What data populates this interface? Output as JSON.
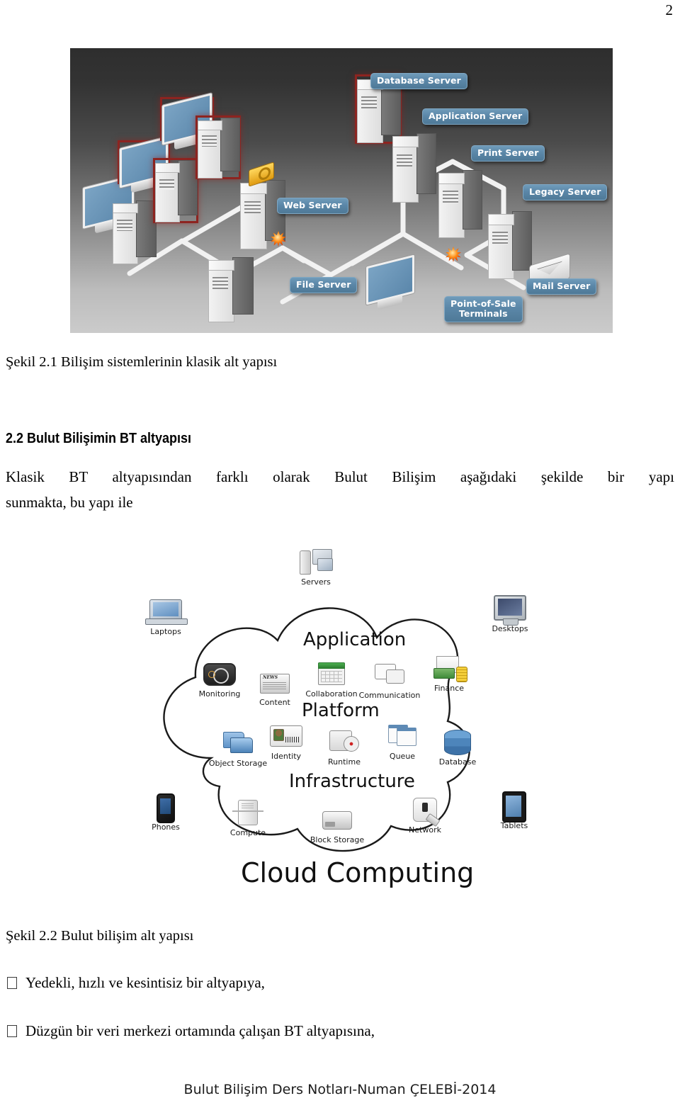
{
  "page": {
    "number": "2",
    "footer": "Bulut Bilişim Ders Notları-Numan ÇELEBİ-2014"
  },
  "figure_classic": {
    "caption": "Şekil 2.1 Bilişim sistemlerinin klasik alt yapısı",
    "labels": {
      "database_server": "Database Server",
      "application_server": "Application Server",
      "print_server": "Print Server",
      "legacy_server": "Legacy Server",
      "web_server": "Web Server",
      "file_server": "File Server",
      "mail_server": "Mail Server",
      "pos_terminals": "Point-of-Sale\nTerminals"
    },
    "badge_color": "#5b87a8",
    "highlight_color": "#8d2420",
    "screen_color": "#5b87ab"
  },
  "section": {
    "heading": "2.2 Bulut Bilişimin BT altyapısı",
    "paragraph_line1": "Klasik BT altyapısından farklı olarak Bulut Bilişim aşağıdaki şekilde bir yapı",
    "paragraph_line2": "sunmakta, bu yapı ile"
  },
  "figure_cloud": {
    "caption": "Şekil 2.2 Bulut bilişim alt yapısı",
    "title": "Cloud Computing",
    "layers": {
      "application": "Application",
      "platform": "Platform",
      "infrastructure": "Infrastructure"
    },
    "outside_items": [
      {
        "id": "servers",
        "label": "Servers"
      },
      {
        "id": "laptops",
        "label": "Laptops"
      },
      {
        "id": "desktops",
        "label": "Desktops"
      },
      {
        "id": "phones",
        "label": "Phones"
      },
      {
        "id": "tablets",
        "label": "Tablets"
      }
    ],
    "application_items": [
      {
        "id": "monitoring",
        "label": "Monitoring"
      },
      {
        "id": "content",
        "label": "Content"
      },
      {
        "id": "collaboration",
        "label": "Collaboration"
      },
      {
        "id": "communication",
        "label": "Communication"
      },
      {
        "id": "finance",
        "label": "Finance"
      }
    ],
    "platform_items": [
      {
        "id": "object-storage",
        "label": "Object Storage"
      },
      {
        "id": "identity",
        "label": "Identity"
      },
      {
        "id": "runtime",
        "label": "Runtime"
      },
      {
        "id": "queue",
        "label": "Queue"
      },
      {
        "id": "database",
        "label": "Database"
      }
    ],
    "infrastructure_items": [
      {
        "id": "compute",
        "label": "Compute"
      },
      {
        "id": "block-storage",
        "label": "Block Storage"
      },
      {
        "id": "network",
        "label": "Network"
      }
    ]
  },
  "bullets": [
    "Yedekli, hızlı ve kesintisiz bir altyapıya,",
    "Düzgün bir veri merkezi ortamında çalışan BT altyapısına,"
  ]
}
